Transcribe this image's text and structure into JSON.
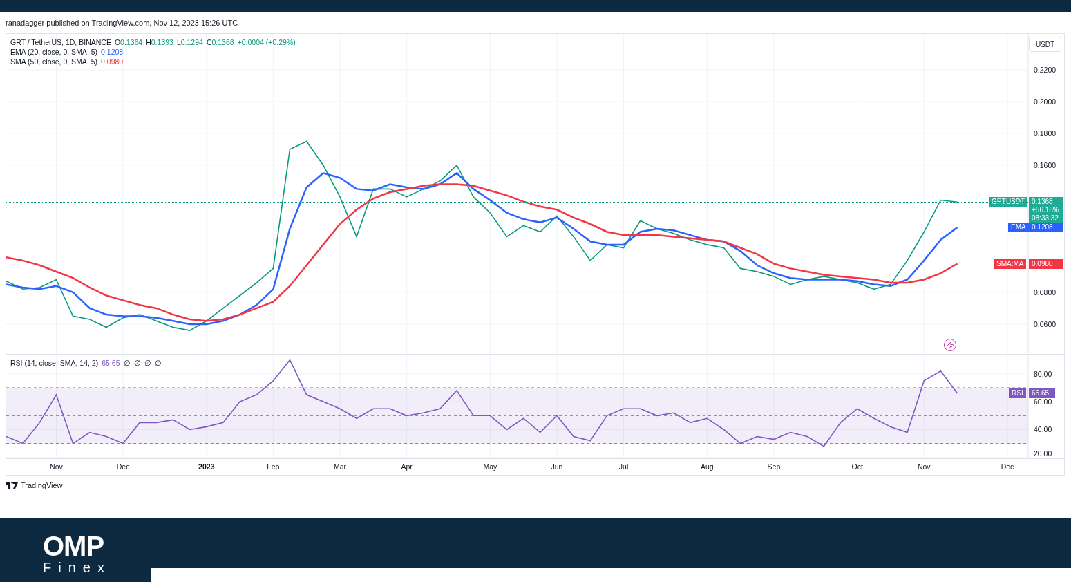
{
  "header": {
    "publisher": "ranadagger published on TradingView.com, Nov 12, 2023 15:26 UTC"
  },
  "legend": {
    "symbol": "GRT / TetherUS, 1D, BINANCE",
    "ohlc": [
      {
        "label": "O",
        "value": "0.1364"
      },
      {
        "label": "H",
        "value": "0.1393"
      },
      {
        "label": "L",
        "value": "0.1294"
      },
      {
        "label": "C",
        "value": "0.1368"
      }
    ],
    "change": "+0.0004 (+0.29%)",
    "indicators": [
      {
        "name": "EMA (20, close, 0, SMA, 5)",
        "value": "0.1208",
        "color": "#2962ff"
      },
      {
        "name": "SMA (50, close, 0, SMA, 5)",
        "value": "0.0980",
        "color": "#f23645"
      }
    ]
  },
  "price_axis": {
    "currency": "USDT"
  },
  "badges": [
    {
      "lines": [
        "0.1368",
        "+56.16%",
        "08:33:32"
      ],
      "color": "#22ab94"
    },
    {
      "lines": [
        "0.1208"
      ],
      "color": "#2962ff"
    },
    {
      "lines": [
        "0.0980"
      ],
      "color": "#f23645"
    }
  ],
  "price_chart": {
    "chart_data": {
      "type": "line",
      "grid": true,
      "ylim": [
        0.0417,
        0.2426
      ],
      "yticks": [
        {
          "value": 0.06,
          "label": "0.0600"
        },
        {
          "value": 0.08,
          "label": "0.0800"
        },
        {
          "value": 0.16,
          "label": "0.1600"
        },
        {
          "value": 0.18,
          "label": "0.1800"
        },
        {
          "value": 0.2,
          "label": "0.2000"
        },
        {
          "value": 0.22,
          "label": "0.2200"
        }
      ],
      "series": [
        {
          "name": "GRTUSDT",
          "color": "#089981",
          "values": [
            0.087,
            0.082,
            0.083,
            0.088,
            0.065,
            0.063,
            0.058,
            0.064,
            0.066,
            0.062,
            0.058,
            0.056,
            0.062,
            0.07,
            0.078,
            0.086,
            0.095,
            0.17,
            0.175,
            0.16,
            0.14,
            0.115,
            0.145,
            0.145,
            0.14,
            0.145,
            0.15,
            0.16,
            0.14,
            0.13,
            0.115,
            0.122,
            0.118,
            0.128,
            0.115,
            0.1,
            0.11,
            0.108,
            0.125,
            0.12,
            0.117,
            0.113,
            0.11,
            0.108,
            0.095,
            0.093,
            0.09,
            0.085,
            0.088,
            0.09,
            0.088,
            0.086,
            0.082,
            0.085,
            0.1,
            0.118,
            0.138,
            0.1368,
            null,
            null,
            null
          ]
        },
        {
          "name": "EMA",
          "color": "#2962ff",
          "values": [
            0.085,
            0.083,
            0.082,
            0.084,
            0.08,
            0.07,
            0.066,
            0.065,
            0.065,
            0.064,
            0.062,
            0.06,
            0.06,
            0.062,
            0.066,
            0.072,
            0.082,
            0.12,
            0.146,
            0.155,
            0.152,
            0.145,
            0.144,
            0.148,
            0.146,
            0.145,
            0.148,
            0.155,
            0.145,
            0.138,
            0.13,
            0.126,
            0.124,
            0.127,
            0.12,
            0.112,
            0.11,
            0.11,
            0.118,
            0.12,
            0.119,
            0.116,
            0.113,
            0.112,
            0.106,
            0.097,
            0.092,
            0.089,
            0.088,
            0.088,
            0.088,
            0.087,
            0.085,
            0.084,
            0.088,
            0.1,
            0.113,
            0.1208,
            null,
            null,
            null
          ]
        },
        {
          "name": "SMA:MA",
          "color": "#f23645",
          "values": [
            0.102,
            0.1,
            0.097,
            0.093,
            0.089,
            0.083,
            0.078,
            0.075,
            0.072,
            0.07,
            0.066,
            0.063,
            0.062,
            0.063,
            0.066,
            0.07,
            0.074,
            0.084,
            0.097,
            0.11,
            0.123,
            0.132,
            0.139,
            0.143,
            0.145,
            0.147,
            0.148,
            0.148,
            0.147,
            0.144,
            0.141,
            0.137,
            0.134,
            0.132,
            0.127,
            0.123,
            0.118,
            0.116,
            0.116,
            0.116,
            0.115,
            0.114,
            0.113,
            0.112,
            0.108,
            0.104,
            0.098,
            0.095,
            0.093,
            0.091,
            0.09,
            0.089,
            0.088,
            0.086,
            0.086,
            0.088,
            0.092,
            0.098,
            null,
            null,
            null
          ]
        }
      ]
    }
  },
  "rsi": {
    "legend": "RSI (14, close, SMA, 14, 2)",
    "value": "65.65",
    "flags": [
      "∅",
      "∅",
      "∅",
      "∅"
    ],
    "badge_value": "65.65",
    "chart_data": {
      "type": "line",
      "grid": true,
      "ylim": [
        19.4,
        93.8
      ],
      "categories": [
        null,
        null,
        null,
        "Nov",
        null,
        null,
        null,
        "Dec",
        null,
        null,
        null,
        null,
        "2023",
        null,
        null,
        null,
        "Feb",
        null,
        null,
        null,
        "Mar",
        null,
        null,
        null,
        "Apr",
        null,
        null,
        null,
        null,
        "May",
        null,
        null,
        null,
        "Jun",
        null,
        null,
        null,
        "Jul",
        null,
        null,
        null,
        null,
        "Aug",
        null,
        null,
        null,
        "Sep",
        null,
        null,
        null,
        null,
        "Oct",
        null,
        null,
        null,
        "Nov",
        null,
        null,
        null,
        null,
        "Dec"
      ],
      "yticks": [
        {
          "value": 20,
          "label": "20.00"
        },
        {
          "value": 40,
          "label": "40.00"
        },
        {
          "value": 60,
          "label": "60.00"
        },
        {
          "value": 80,
          "label": "80.00"
        }
      ],
      "series": [
        {
          "name": "RSI",
          "color": "#7e57c2",
          "values": [
            35,
            30,
            45,
            65,
            30,
            38,
            35,
            30,
            45,
            45,
            47,
            40,
            42,
            45,
            60,
            65,
            75,
            90,
            65,
            60,
            55,
            48,
            55,
            55,
            50,
            52,
            55,
            68,
            50,
            50,
            40,
            48,
            38,
            50,
            35,
            32,
            50,
            55,
            55,
            50,
            52,
            45,
            48,
            40,
            30,
            35,
            33,
            38,
            35,
            28,
            45,
            55,
            48,
            42,
            38,
            75,
            82,
            66,
            null,
            null,
            null
          ]
        }
      ]
    }
  },
  "footer": {
    "logo": "TradingView"
  },
  "brand": {
    "name": "OMP",
    "sub": "Finex"
  }
}
